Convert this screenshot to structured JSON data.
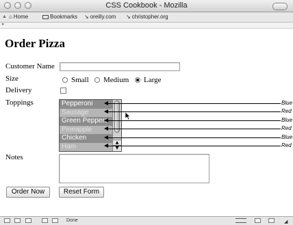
{
  "window": {
    "title": "CSS Cookbook - Mozilla"
  },
  "toolbar": {
    "home_label": "Home",
    "bookmarks_label": "Bookmarks",
    "links": [
      "oreilly.com",
      "christopher.org"
    ]
  },
  "page": {
    "title": "Order Pizza",
    "form": {
      "customer_name_label": "Customer Name",
      "customer_name_value": "",
      "size_label": "Size",
      "size_options": [
        {
          "label": "Small",
          "selected": false
        },
        {
          "label": "Medium",
          "selected": false
        },
        {
          "label": "Large",
          "selected": true
        }
      ],
      "delivery_label": "Delivery",
      "delivery_checked": false,
      "toppings_label": "Toppings",
      "toppings": [
        {
          "label": "Pepperoni",
          "annotation": "Blue"
        },
        {
          "label": "Sausage",
          "annotation": "Red"
        },
        {
          "label": "Green Peppers",
          "annotation": "Blue"
        },
        {
          "label": "Pineapple",
          "annotation": "Red"
        },
        {
          "label": "Chicken",
          "annotation": "Blue"
        },
        {
          "label": "Ham",
          "annotation": "Red"
        }
      ],
      "notes_label": "Notes",
      "notes_value": "",
      "order_button": "Order Now",
      "reset_button": "Reset Form"
    }
  },
  "status": {
    "text": "Done"
  }
}
